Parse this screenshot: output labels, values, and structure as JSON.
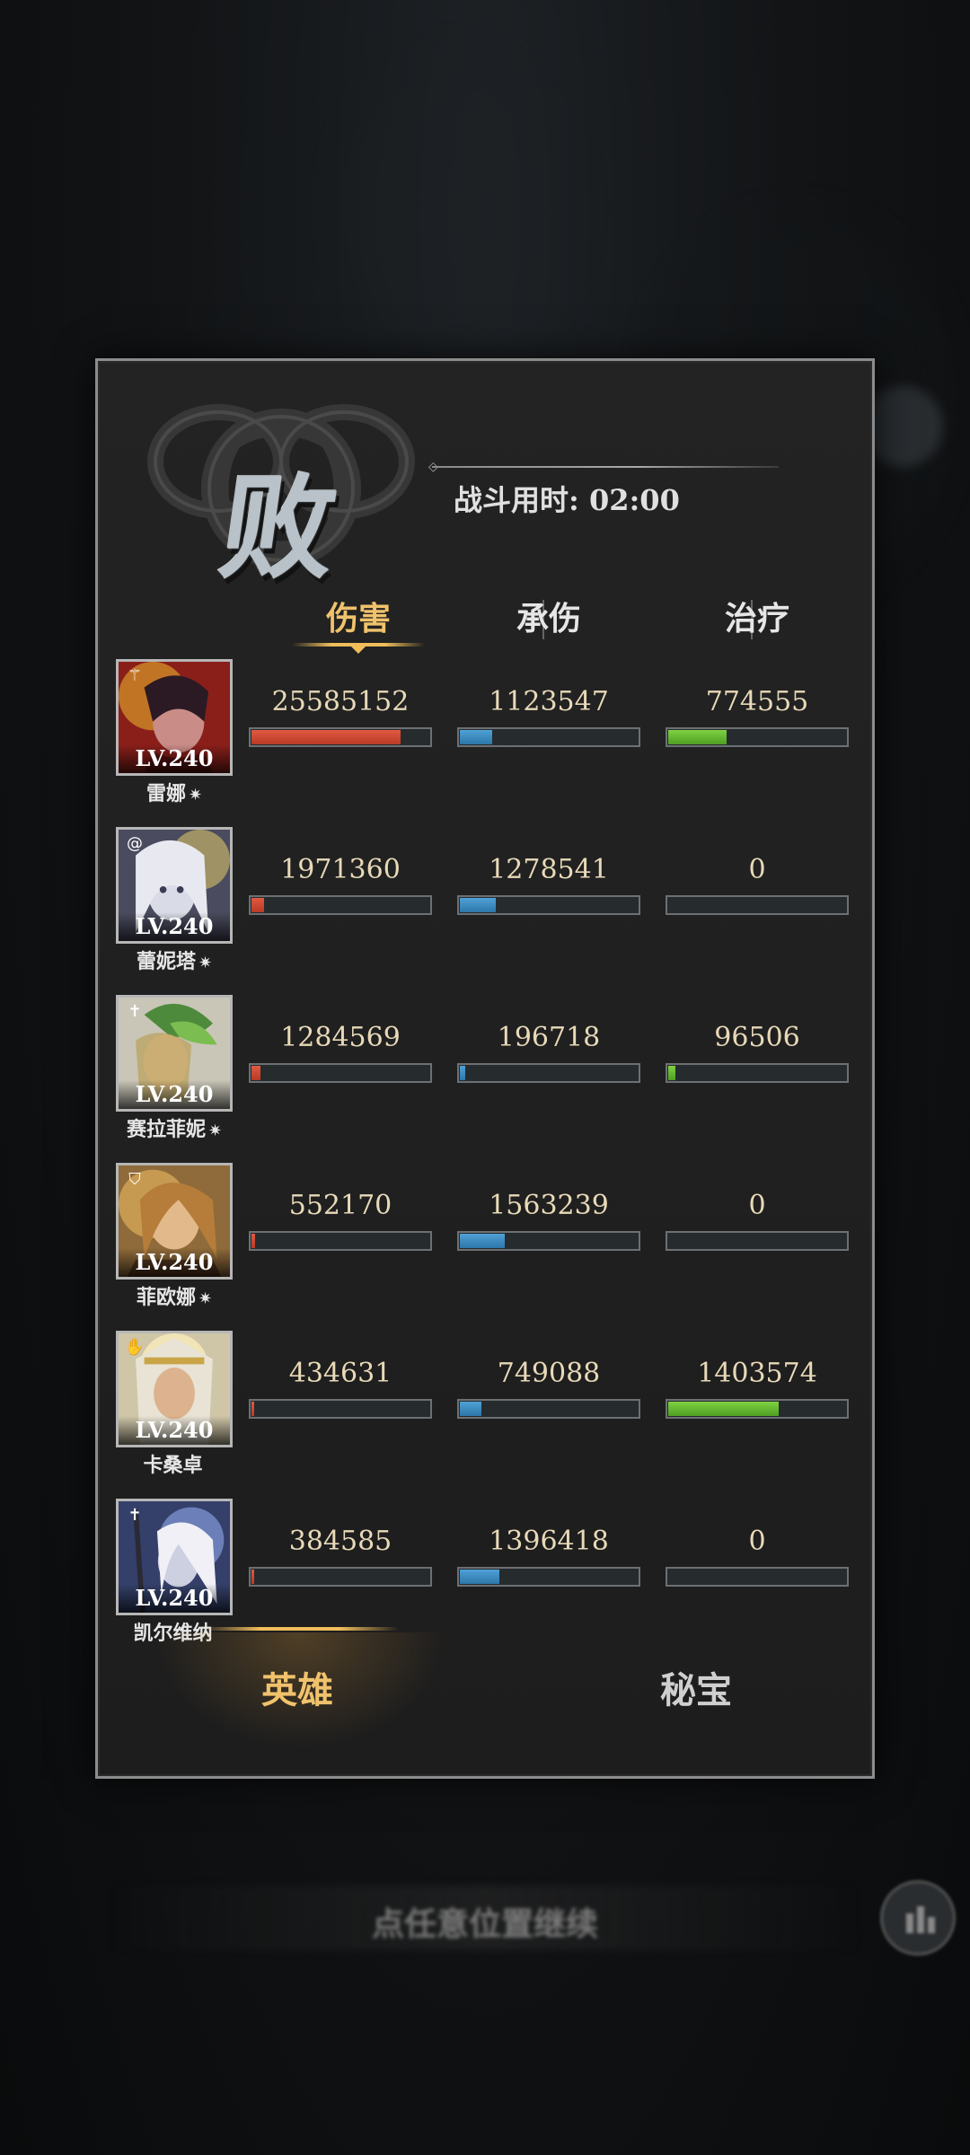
{
  "result": {
    "title": "败",
    "battle_time_label": "战斗用时: 02:00"
  },
  "stat_tabs": [
    {
      "label": "伤害",
      "active": true
    },
    {
      "label": "承伤",
      "active": false
    },
    {
      "label": "治疗",
      "active": false
    }
  ],
  "colors": {
    "damage": "#d0462e",
    "tank": "#3f8ec4",
    "heal": "#68b831",
    "accent": "#f0c26c"
  },
  "heroes": [
    {
      "name": "雷娜",
      "star": "✷",
      "level": "LV.240",
      "class_icon": "staff-icon",
      "damage": "25585152",
      "tank": "1123547",
      "heal": "774555",
      "damage_ratio": 0.84,
      "tank_ratio": 0.18,
      "heal_ratio": 0.33
    },
    {
      "name": "蕾妮塔",
      "star": "✷",
      "level": "LV.240",
      "class_icon": "swirl-icon",
      "damage": "1971360",
      "tank": "1278541",
      "heal": "0",
      "damage_ratio": 0.07,
      "tank_ratio": 0.2,
      "heal_ratio": 0
    },
    {
      "name": "赛拉菲妮",
      "star": "✷",
      "level": "LV.240",
      "class_icon": "cross-icon",
      "damage": "1284569",
      "tank": "196718",
      "heal": "96506",
      "damage_ratio": 0.05,
      "tank_ratio": 0.03,
      "heal_ratio": 0.04
    },
    {
      "name": "菲欧娜",
      "star": "✷",
      "level": "LV.240",
      "class_icon": "shield-icon",
      "damage": "552170",
      "tank": "1563239",
      "heal": "0",
      "damage_ratio": 0.02,
      "tank_ratio": 0.25,
      "heal_ratio": 0
    },
    {
      "name": "卡桑卓",
      "star": "",
      "level": "LV.240",
      "class_icon": "hand-icon",
      "damage": "434631",
      "tank": "749088",
      "heal": "1403574",
      "damage_ratio": 0.015,
      "tank_ratio": 0.12,
      "heal_ratio": 0.62
    },
    {
      "name": "凯尔维纳",
      "star": "",
      "level": "LV.240",
      "class_icon": "cross-icon",
      "damage": "384585",
      "tank": "1396418",
      "heal": "0",
      "damage_ratio": 0.013,
      "tank_ratio": 0.22,
      "heal_ratio": 0
    }
  ],
  "bottom_tabs": [
    {
      "label": "英雄",
      "active": true
    },
    {
      "label": "秘宝",
      "active": false
    }
  ],
  "tap_hint": "点任意位置继续"
}
